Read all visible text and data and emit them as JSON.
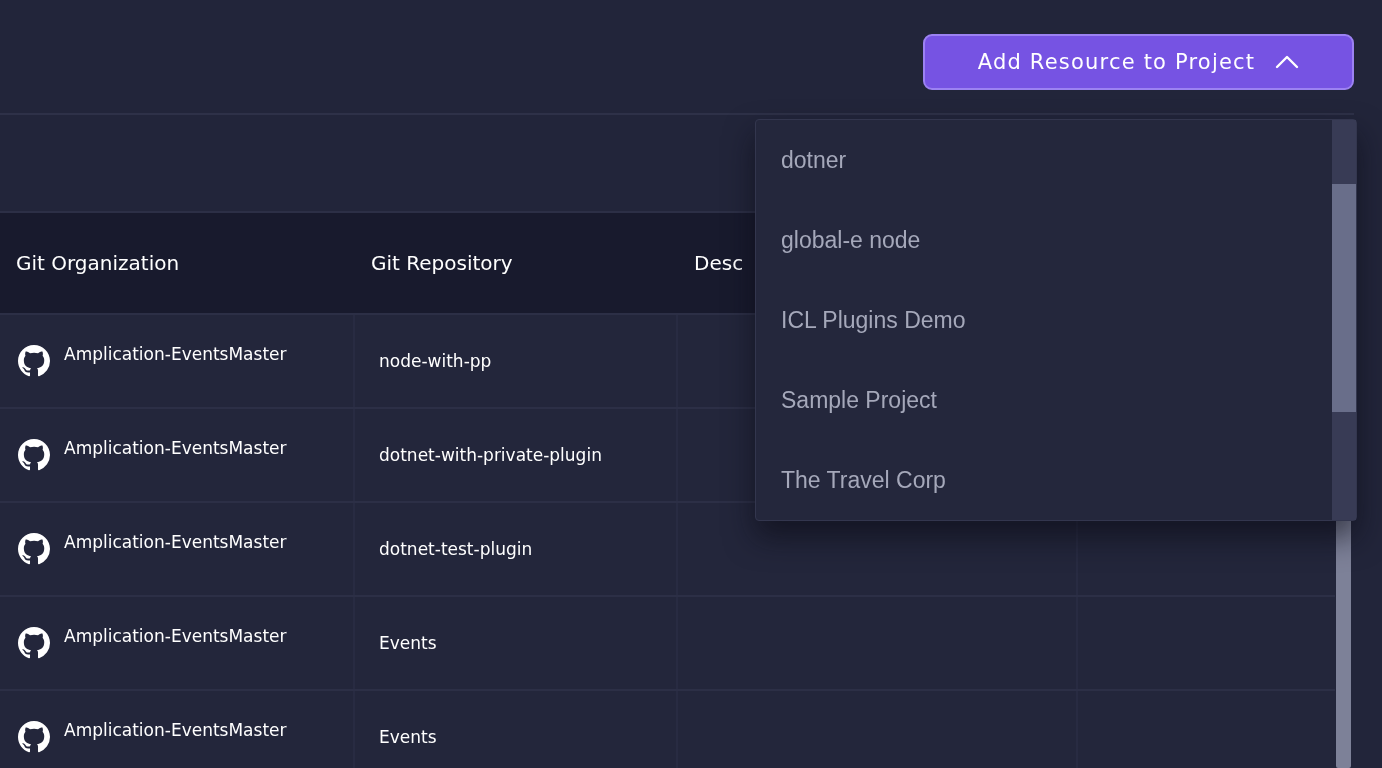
{
  "add_button": {
    "label": "Add Resource to Project",
    "expanded": true
  },
  "table": {
    "columns": [
      "Git Organization",
      "Git Repository",
      "Desc",
      ""
    ],
    "rows": [
      {
        "organization": "Amplication-EventsMaster",
        "repository": "node-with-pp"
      },
      {
        "organization": "Amplication-EventsMaster",
        "repository": "dotnet-with-private-plugin"
      },
      {
        "organization": "Amplication-EventsMaster",
        "repository": "dotnet-test-plugin"
      },
      {
        "organization": "Amplication-EventsMaster",
        "repository": "Events"
      },
      {
        "organization": "Amplication-EventsMaster",
        "repository": "Events"
      }
    ]
  },
  "dropdown": {
    "items": [
      {
        "label": "dotner"
      },
      {
        "label": "global-e node"
      },
      {
        "label": "ICL Plugins Demo"
      },
      {
        "label": "Sample Project"
      },
      {
        "label": "The Travel Corp"
      }
    ]
  }
}
